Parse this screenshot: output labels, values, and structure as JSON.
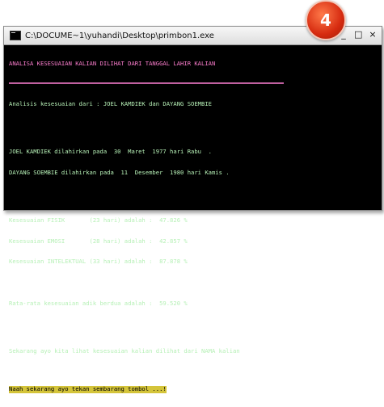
{
  "badge": {
    "number": "4"
  },
  "window": {
    "title": "C:\\DOCUME~1\\yuhandi\\Desktop\\primbon1.exe",
    "controls": {
      "minimize": "_",
      "maximize": "□",
      "close": "×"
    }
  },
  "console": {
    "header": "ANALISA KESESUAIAN KALIAN DILIHAT DARI TANGGAL LAHIR KALIAN",
    "analysis": "Analisis kesesuaian dari : JOEL KAMDIEK dan DAYANG SOEMBIE",
    "birth_line_1": "JOEL KAMDIEK dilahirkan pada  30  Maret  1977 hari Rabu  .",
    "birth_line_2": "DAYANG SOEMBIE dilahirkan pada  11  Desember  1980 hari Kamis .",
    "fisik": "Kesesuaian FISIK       (23 hari) adalah :  47.826 %",
    "emosi": "Kesesuaian EMOSI       (28 hari) adalah :  42.857 %",
    "intelektual": "Kesesuaian INTELEKTUAL (33 hari) adalah :  87.878 %",
    "average": "Rata-rata kesesuaian adik berdua adalah :  59.520 %",
    "next": "Sekarang ayo kita lihat kesesuaian kalian dilihat dari NAMA kalian",
    "prompt": "Naah sekarang ayo tekan sembarang tombol ...!"
  },
  "colors": {
    "console_text": "#b6f0b6",
    "header_text": "#ff7fd0",
    "prompt_highlight": "#d4c43a",
    "badge": "#d62b10"
  }
}
